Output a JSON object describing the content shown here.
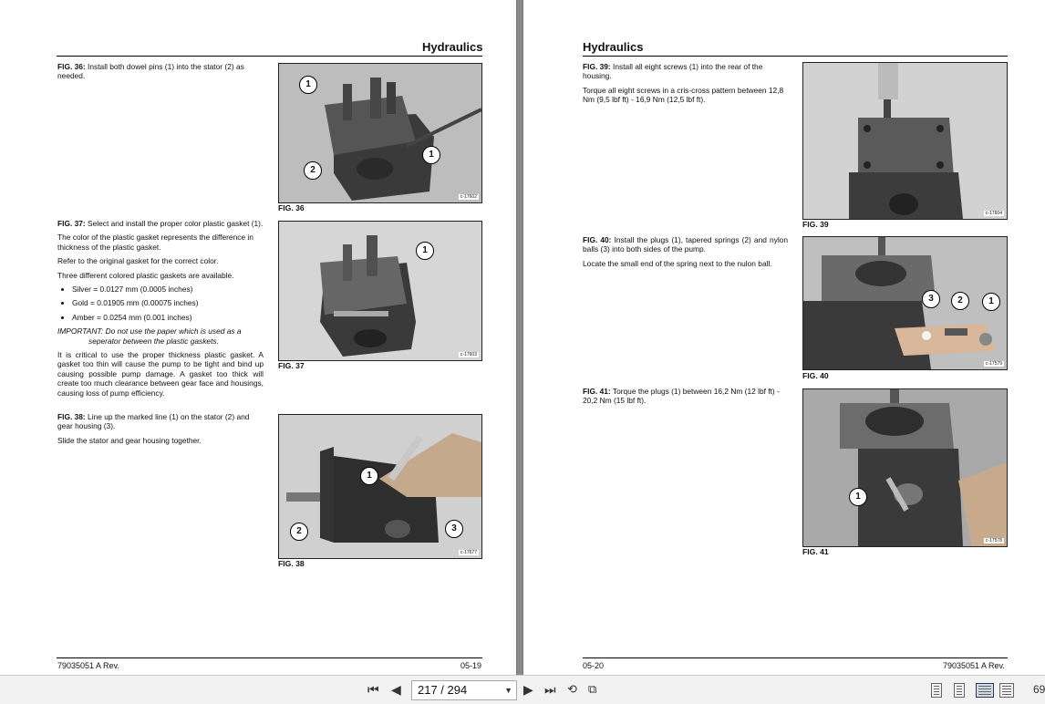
{
  "left_page": {
    "header": "Hydraulics",
    "footer_left": "79035051 A Rev.",
    "footer_right": "05-19",
    "fig36": {
      "lead": "FIG. 36:",
      "text": " Install both dowel pins (1) into the stator (2) as needed.",
      "caption": "FIG. 36",
      "photo_id": "c-17602",
      "callouts": [
        "1",
        "1",
        "2"
      ]
    },
    "fig37": {
      "lead": "FIG. 37:",
      "text": " Select and install the proper color plastic gasket (1).",
      "p2": "The color of the plastic gasket represents the difference in thickness of the plastic gasket.",
      "p3": "Refer to the original gasket for the correct color.",
      "p4": "Three different colored plastic gaskets are available.",
      "bullets": [
        "Silver = 0.0127 mm (0.0005 inches)",
        "Gold = 0.01905 mm (0.00075 inches)",
        "Amber = 0.0254 mm (0.001 inches)"
      ],
      "important_1": "IMPORTANT: Do not use the paper which is used as a",
      "important_2": "seperator between the plastic gaskets.",
      "p5": "It is critical to use the proper thickness plastic gasket. A gasket too thin will cause the pump to be tight and bind up causing possible pump damage. A gasket too thick will create too much clearance between gear face and housings, causing loss of pump efficiency.",
      "caption": "FIG. 37",
      "photo_id": "c-17603",
      "callouts": [
        "1"
      ]
    },
    "fig38": {
      "lead": "FIG. 38:",
      "text": " Line up the marked line (1) on the stator (2) and gear housing (3).",
      "p2": "Slide the stator and gear housing together.",
      "caption": "FIG. 38",
      "photo_id": "c-17677",
      "callouts": [
        "1",
        "2",
        "3"
      ]
    }
  },
  "right_page": {
    "header": "Hydraulics",
    "footer_left": "05-20",
    "footer_right": "79035051 A Rev.",
    "fig39": {
      "lead": "FIG. 39:",
      "text": " Install all eight screws (1) into the rear of the housing.",
      "p2": "Torque all eight screws in a cris-cross pattern between 12,8 Nm (9,5 lbf ft) - 16,9 Nm (12,5 lbf ft).",
      "caption": "FIG. 39",
      "photo_id": "c-17604"
    },
    "fig40": {
      "lead": "FIG. 40:",
      "text": " Install the plugs (1), tapered springs (2) and nylon balls (3) into both sides of the pump.",
      "p2": "Locate the small end of the spring next to the nulon ball.",
      "caption": "FIG. 40",
      "photo_id": "c-17579",
      "callouts": [
        "3",
        "2",
        "1"
      ]
    },
    "fig41": {
      "lead": "FIG. 41:",
      "text": " Torque the plugs (1) between 16,2 Nm (12 lbf ft) - 20,2 Nm (15 lbf ft).",
      "caption": "FIG. 41",
      "photo_id": "c-17578",
      "callouts": [
        "1"
      ]
    }
  },
  "toolbar": {
    "page_indicator": "217 / 294",
    "zoom_partial": "69",
    "icons": [
      "first-page-icon",
      "prev-page-icon",
      "dropdown-icon",
      "next-page-icon",
      "last-page-icon",
      "rotate-icon",
      "compare-icon",
      "single-page-view-icon",
      "continuous-view-icon",
      "two-page-view-icon",
      "two-page-continuous-view-icon"
    ]
  }
}
